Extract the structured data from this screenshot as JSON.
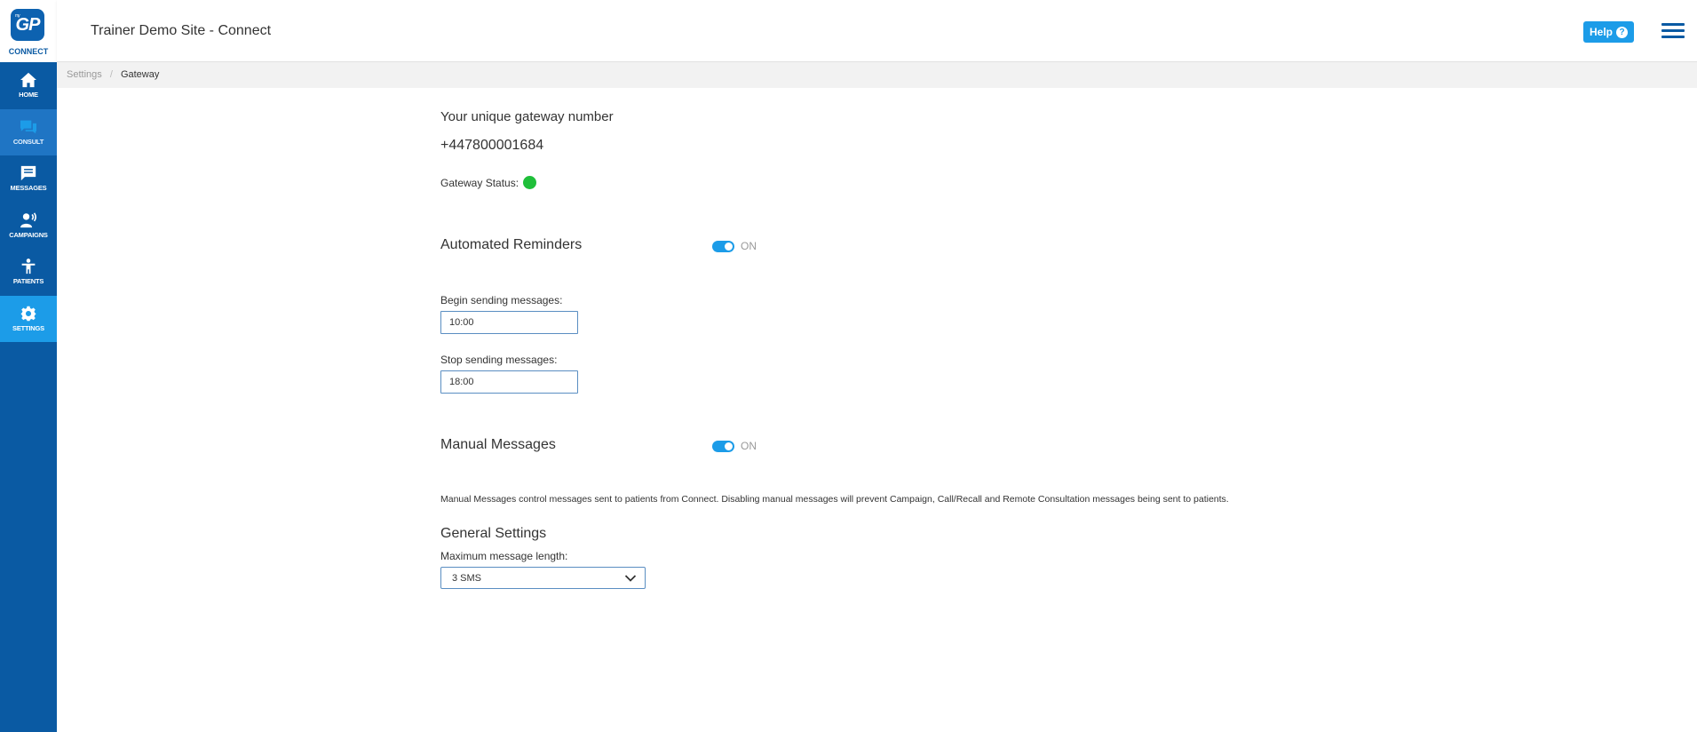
{
  "app": {
    "logo_text": "GP",
    "logo_small": "my",
    "logo_label": "CONNECT",
    "site_title": "Trainer Demo Site - Connect",
    "help_label": "Help",
    "help_icon_glyph": "?"
  },
  "colors": {
    "sidebar": "#0a5aa3",
    "active": "#1c9ce8",
    "status_online": "#1fbf3a"
  },
  "sidebar": {
    "items": [
      {
        "label": "HOME",
        "icon": "home-icon"
      },
      {
        "label": "CONSULT",
        "icon": "chat-bubbles-icon"
      },
      {
        "label": "MESSAGES",
        "icon": "message-icon"
      },
      {
        "label": "CAMPAIGNS",
        "icon": "campaign-icon"
      },
      {
        "label": "PATIENTS",
        "icon": "person-icon"
      },
      {
        "label": "SETTINGS",
        "icon": "gear-icon"
      }
    ],
    "active": "SETTINGS"
  },
  "breadcrumb": {
    "parent": "Settings",
    "separator": "/",
    "current": "Gateway"
  },
  "gateway": {
    "heading": "Your unique gateway number",
    "number": "+447800001684",
    "status_label": "Gateway Status:",
    "status": "online"
  },
  "automated_reminders": {
    "title": "Automated Reminders",
    "toggle_label": "ON",
    "enabled": true,
    "begin_label": "Begin sending messages:",
    "begin_value": "10:00",
    "stop_label": "Stop sending messages:",
    "stop_value": "18:00"
  },
  "manual_messages": {
    "title": "Manual Messages",
    "toggle_label": "ON",
    "enabled": true,
    "description": "Manual Messages control messages sent to patients from Connect. Disabling manual messages will prevent Campaign, Call/Recall and Remote Consultation messages being sent to patients."
  },
  "general_settings": {
    "title": "General Settings",
    "max_length_label": "Maximum message length:",
    "max_length_value": "3 SMS"
  }
}
